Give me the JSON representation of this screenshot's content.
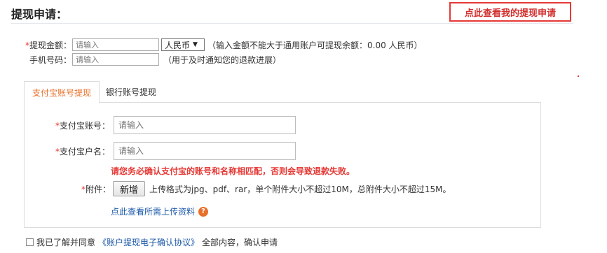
{
  "page": {
    "title": "提现申请：",
    "view_link": "点此查看我的提现申请"
  },
  "form": {
    "amount": {
      "required": "*",
      "label": "提现金额：",
      "placeholder": "请输入",
      "currency": "人民币",
      "currency_arrow": "▼",
      "hint": "（输入金额不能大于通用账户可提现余额：0.00 人民币）"
    },
    "phone": {
      "label": "手机号码：",
      "placeholder": "请输入",
      "hint": "（用于及时通知您的退款进展）"
    }
  },
  "tabs": {
    "alipay": "支付宝账号提现",
    "bank": "银行账号提现"
  },
  "alipay": {
    "account": {
      "required": "*",
      "label": "支付宝账号：",
      "placeholder": "请输入"
    },
    "name": {
      "required": "*",
      "label": "支付宝户名：",
      "placeholder": "请输入"
    },
    "warning": "请您务必确认支付宝的账号和名称相匹配，否则会导致退款失败。",
    "attachment": {
      "required": "*",
      "label": "附件：",
      "button": "新增",
      "hint": "上传格式为jpg、pdf、rar，单个附件大小不超过10M，总附件大小不超过15M。"
    },
    "help_link": "点此查看所需上传资料",
    "help_icon": "?"
  },
  "agreement": {
    "prefix": "我已了解并同意",
    "link": "《账户提现电子确认协议》",
    "suffix": "全部内容，确认申请"
  }
}
